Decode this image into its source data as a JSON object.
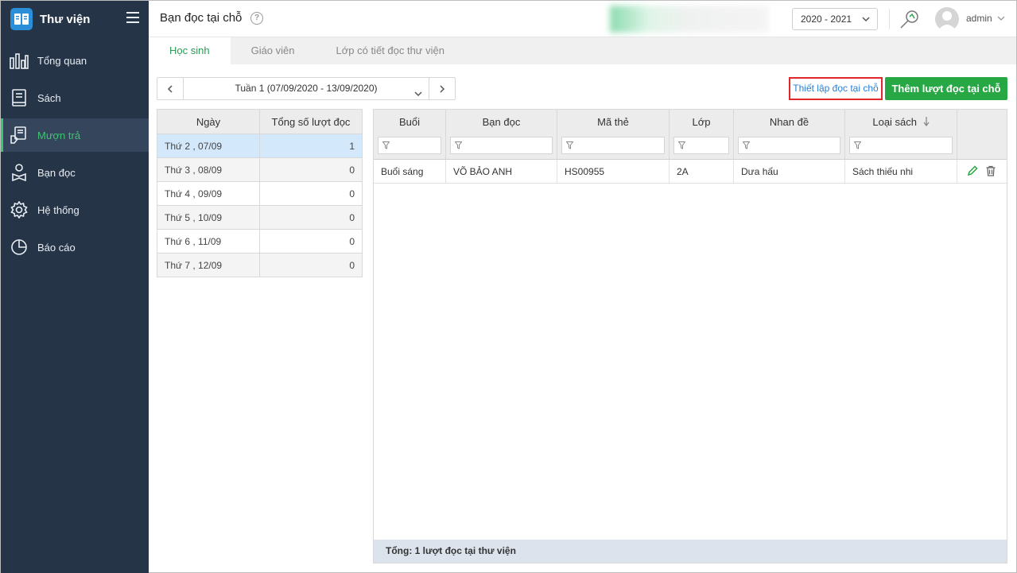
{
  "app": {
    "title": "Thư viện"
  },
  "sidebar": {
    "items": [
      {
        "label": "Tổng quan",
        "icon": "bar-chart-icon",
        "active": false
      },
      {
        "label": "Sách",
        "icon": "book-icon",
        "active": false
      },
      {
        "label": "Mượn trả",
        "icon": "hand-book-icon",
        "active": true
      },
      {
        "label": "Bạn đọc",
        "icon": "reader-icon",
        "active": false
      },
      {
        "label": "Hệ thống",
        "icon": "gear-icon",
        "active": false
      },
      {
        "label": "Báo cáo",
        "icon": "pie-chart-icon",
        "active": false
      }
    ],
    "accent": "#3ec472"
  },
  "header": {
    "page_title": "Bạn đọc tại chỗ",
    "year": "2020 - 2021",
    "username": "admin"
  },
  "tabs": [
    "Học sinh",
    "Giáo viên",
    "Lớp có tiết đọc thư viện"
  ],
  "week": {
    "label": "Tuần 1 (07/09/2020 - 13/09/2020)"
  },
  "actions": {
    "setup_link": "Thiết lập đọc tại chỗ",
    "add_button": "Thêm lượt đọc tại chỗ"
  },
  "day_table": {
    "headers": [
      "Ngày",
      "Tổng số lượt đọc"
    ],
    "rows": [
      {
        "day": "Thứ 2 , 07/09",
        "count": "1"
      },
      {
        "day": "Thứ 3 , 08/09",
        "count": "0"
      },
      {
        "day": "Thứ 4 , 09/09",
        "count": "0"
      },
      {
        "day": "Thứ 5 , 10/09",
        "count": "0"
      },
      {
        "day": "Thứ 6 , 11/09",
        "count": "0"
      },
      {
        "day": "Thứ 7 , 12/09",
        "count": "0"
      }
    ]
  },
  "grid": {
    "headers": [
      "Buổi",
      "Bạn đọc",
      "Mã thẻ",
      "Lớp",
      "Nhan đề",
      "Loại sách"
    ],
    "rows": [
      [
        "Buổi sáng",
        "VÕ BẢO ANH",
        "HS00955",
        "2A",
        "Dưa hấu",
        "Sách thiếu nhi"
      ]
    ],
    "footer_prefix": "Tổng: ",
    "footer_count": "1",
    "footer_suffix": " lượt đọc tại thư viện"
  },
  "colors": {
    "primary_green": "#28a745",
    "sidebar_bg": "#263447",
    "link_blue": "#2a7fd4",
    "highlight_red": "#e0282a"
  }
}
